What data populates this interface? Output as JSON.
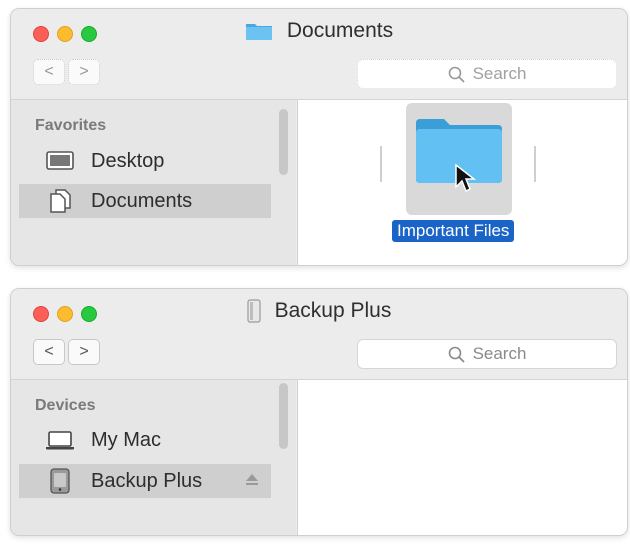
{
  "window_top": {
    "title": "Documents",
    "search_placeholder": "Search",
    "nav_back": "<",
    "nav_forward": ">",
    "sidebar": {
      "section": "Favorites",
      "items": [
        {
          "label": "Desktop",
          "icon": "desktop-icon",
          "selected": false
        },
        {
          "label": "Documents",
          "icon": "documents-icon",
          "selected": true
        }
      ]
    },
    "content": {
      "items": [
        {
          "label": "Important Files",
          "icon": "folder-icon",
          "selected": true
        }
      ]
    }
  },
  "window_bottom": {
    "title": "Backup Plus",
    "search_placeholder": "Search",
    "nav_back": "<",
    "nav_forward": ">",
    "sidebar": {
      "section": "Devices",
      "items": [
        {
          "label": "My Mac",
          "icon": "laptop-icon",
          "selected": false
        },
        {
          "label": "Backup Plus",
          "icon": "external-drive-icon",
          "selected": true,
          "ejectable": true
        }
      ]
    },
    "content": {
      "items": []
    }
  },
  "colors": {
    "selection_blue": "#1a64c8",
    "folder_blue": "#5cbcf0",
    "close_red": "#fc5f57",
    "minimize_yellow": "#fdbc2e",
    "zoom_green": "#28c840"
  }
}
